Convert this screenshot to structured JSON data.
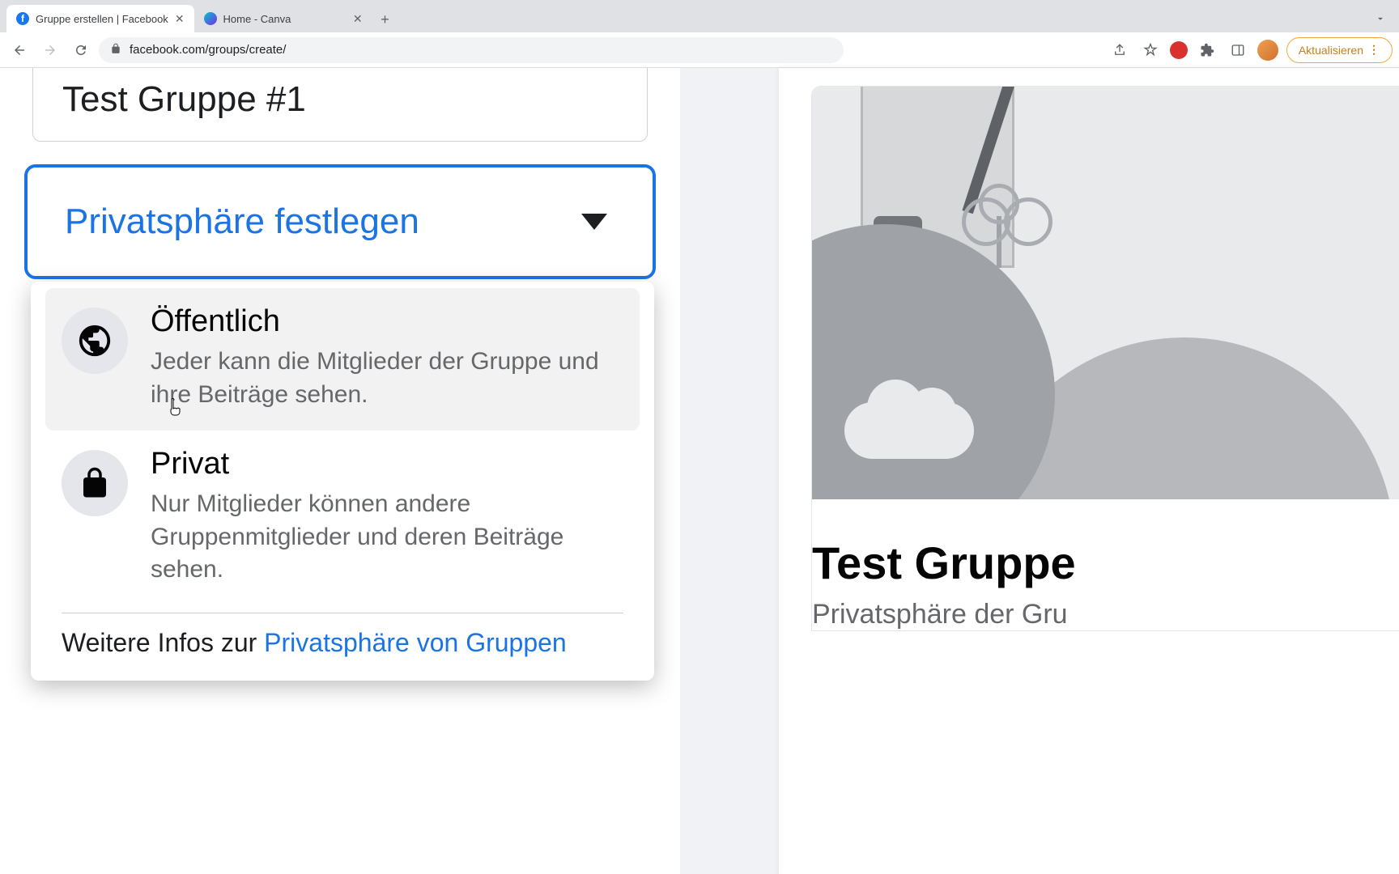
{
  "browser": {
    "tabs": [
      {
        "title": "Gruppe erstellen | Facebook"
      },
      {
        "title": "Home - Canva"
      }
    ],
    "url": "facebook.com/groups/create/",
    "update_label": "Aktualisieren"
  },
  "form": {
    "group_name": "Test Gruppe #1",
    "privacy_select_label": "Privatsphäre festlegen",
    "options": [
      {
        "title": "Öffentlich",
        "desc": "Jeder kann die Mitglieder der Gruppe und ihre Beiträge sehen."
      },
      {
        "title": "Privat",
        "desc": "Nur Mitglieder können andere Gruppenmitglieder und deren Beiträge sehen."
      }
    ],
    "more_info_prefix": "Weitere Infos zur ",
    "more_info_link": "Privatsphäre von Gruppen"
  },
  "preview": {
    "title": "Test Gruppe",
    "subtitle": "Privatsphäre der Gru"
  }
}
